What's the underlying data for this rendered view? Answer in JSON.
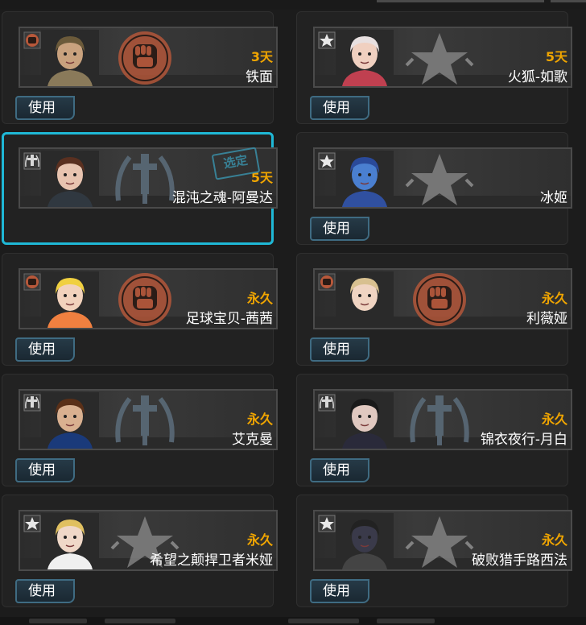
{
  "use_label": "使用",
  "selected_stamp": "选定",
  "accent_cyan": "#1fb8d6",
  "duration_color": "#f0a500",
  "class_fist_color": "#b8583a",
  "class_star_color": "#8a8a8a",
  "class_sword_color": "#5a6a78",
  "characters": [
    {
      "duration": "3天",
      "name": "铁面",
      "class_icon": "fist-icon",
      "selected": false
    },
    {
      "duration": "5天",
      "name": "火狐-如歌",
      "class_icon": "star-icon",
      "selected": false
    },
    {
      "duration": "5天",
      "name": "混沌之魂-阿曼达",
      "class_icon": "sword-icon",
      "selected": true
    },
    {
      "duration": "",
      "name": "冰姬",
      "class_icon": "star-icon",
      "selected": false
    },
    {
      "duration": "永久",
      "name": "足球宝贝-茜茜",
      "class_icon": "fist-icon",
      "selected": false
    },
    {
      "duration": "永久",
      "name": "利薇娅",
      "class_icon": "fist-icon",
      "selected": false
    },
    {
      "duration": "永久",
      "name": "艾克曼",
      "class_icon": "sword-icon",
      "selected": false
    },
    {
      "duration": "永久",
      "name": "锦衣夜行-月白",
      "class_icon": "sword-icon",
      "selected": false
    },
    {
      "duration": "永久",
      "name": "希望之颠捍卫者米娅",
      "class_icon": "star-icon",
      "selected": false
    },
    {
      "duration": "永久",
      "name": "破败猎手路西法",
      "class_icon": "star-icon",
      "selected": false
    }
  ]
}
